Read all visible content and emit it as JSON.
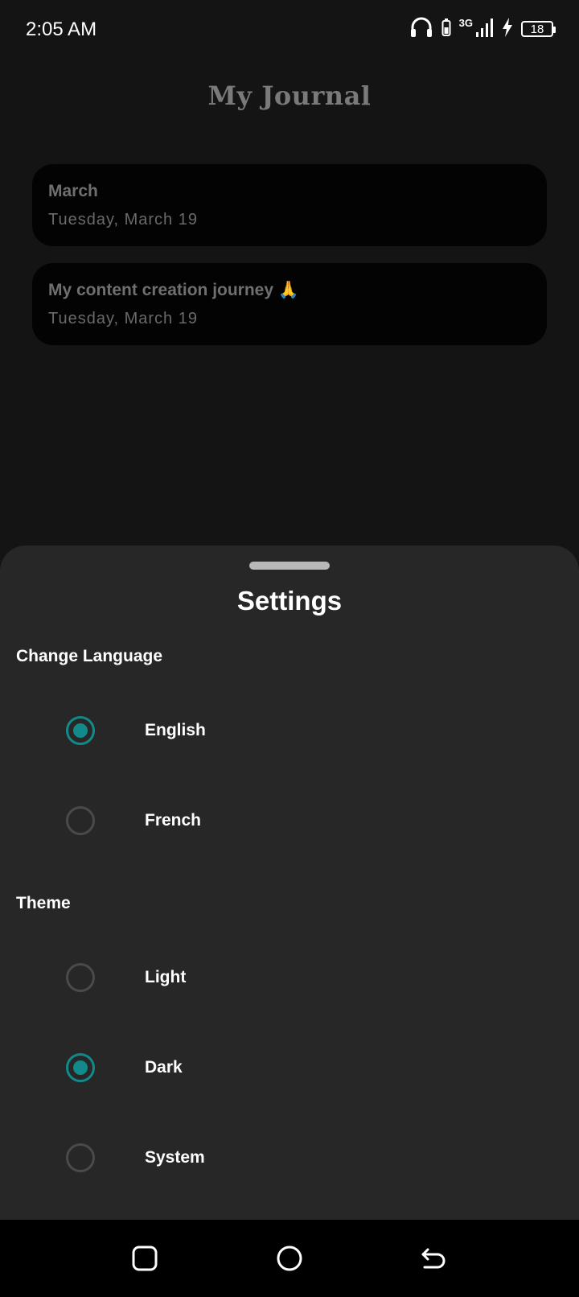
{
  "status_bar": {
    "time": "2:05 AM",
    "network": "3G",
    "battery": "18"
  },
  "app": {
    "title": "My Journal"
  },
  "entries": [
    {
      "title": "March",
      "date": "Tuesday, March 19"
    },
    {
      "title": "My content creation journey 🙏",
      "date": "Tuesday, March 19"
    }
  ],
  "settings": {
    "title": "Settings",
    "language": {
      "heading": "Change Language",
      "options": [
        {
          "label": "English",
          "selected": true
        },
        {
          "label": "French",
          "selected": false
        }
      ]
    },
    "theme": {
      "heading": "Theme",
      "options": [
        {
          "label": "Light",
          "selected": false
        },
        {
          "label": "Dark",
          "selected": true
        },
        {
          "label": "System",
          "selected": false
        }
      ]
    }
  },
  "colors": {
    "accent": "#128a8a",
    "sheet_bg": "#272727",
    "screen_bg": "#141414"
  },
  "icons": {
    "status": [
      "headphones-icon",
      "battery-saver-icon",
      "signal-icon",
      "charging-icon",
      "battery-icon"
    ],
    "nav": [
      "recents-icon",
      "home-icon",
      "back-icon"
    ]
  }
}
